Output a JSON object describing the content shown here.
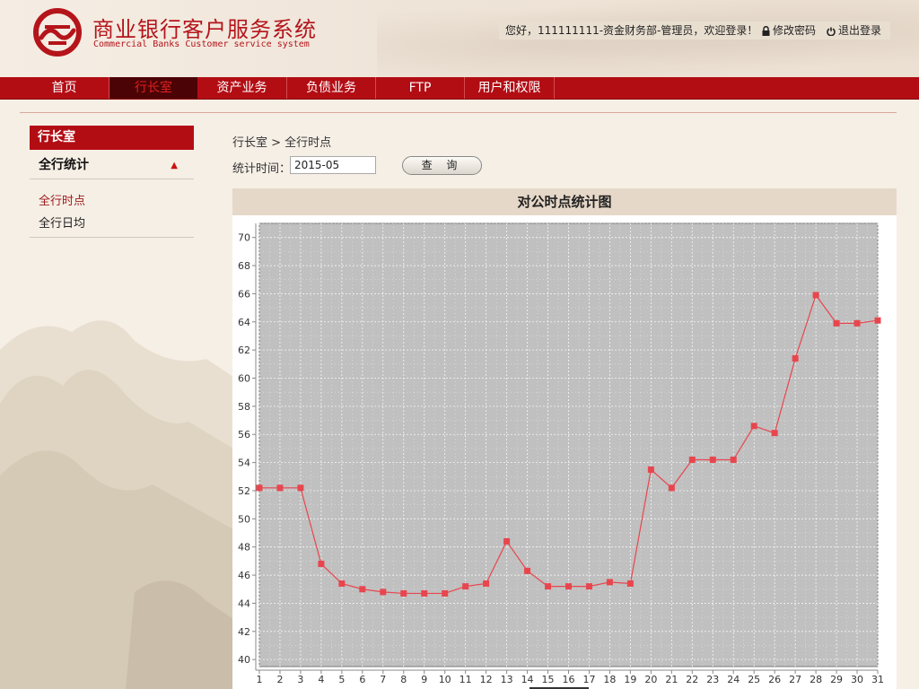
{
  "header": {
    "title": "商业银行客户服务系统",
    "subtitle": "Commercial Banks Customer service system",
    "greeting": "您好，111111111-资金财务部-管理员，欢迎登录！",
    "change_password": "修改密码",
    "logout": "退出登录"
  },
  "nav": [
    {
      "label": "首页"
    },
    {
      "label": "行长室"
    },
    {
      "label": "资产业务"
    },
    {
      "label": "负债业务"
    },
    {
      "label": "FTP"
    },
    {
      "label": "用户和权限"
    }
  ],
  "sidebar": {
    "title": "行长室",
    "group": "全行统计",
    "items": [
      {
        "label": "全行时点"
      },
      {
        "label": "全行日均"
      }
    ]
  },
  "breadcrumb": "行长室 > 全行时点",
  "filter": {
    "label": "统计时间：",
    "value": "2015-05",
    "button": "查 询"
  },
  "colors": {
    "accent": "#b30d14",
    "series": "#e8464e",
    "plot_bg": "#c0c0c0"
  },
  "chart_data": {
    "type": "line",
    "title": "对公时点统计图",
    "x": [
      1,
      2,
      3,
      4,
      5,
      6,
      7,
      8,
      9,
      10,
      11,
      12,
      13,
      14,
      15,
      16,
      17,
      18,
      19,
      20,
      21,
      22,
      23,
      24,
      25,
      26,
      27,
      28,
      29,
      30,
      31
    ],
    "series": [
      {
        "values": [
          52.2,
          52.2,
          52.2,
          46.8,
          45.4,
          45.0,
          44.8,
          44.7,
          44.7,
          44.7,
          45.2,
          45.4,
          48.4,
          46.3,
          45.2,
          45.2,
          45.2,
          45.5,
          45.4,
          53.5,
          52.2,
          54.2,
          54.2,
          54.2,
          56.6,
          56.1,
          61.4,
          65.9,
          63.9,
          63.9,
          64.1
        ]
      }
    ],
    "ylim": [
      39.5,
      71
    ],
    "yticks": [
      40,
      42,
      44,
      46,
      48,
      50,
      52,
      54,
      56,
      58,
      60,
      62,
      64,
      66,
      68,
      70
    ],
    "grid": true
  }
}
